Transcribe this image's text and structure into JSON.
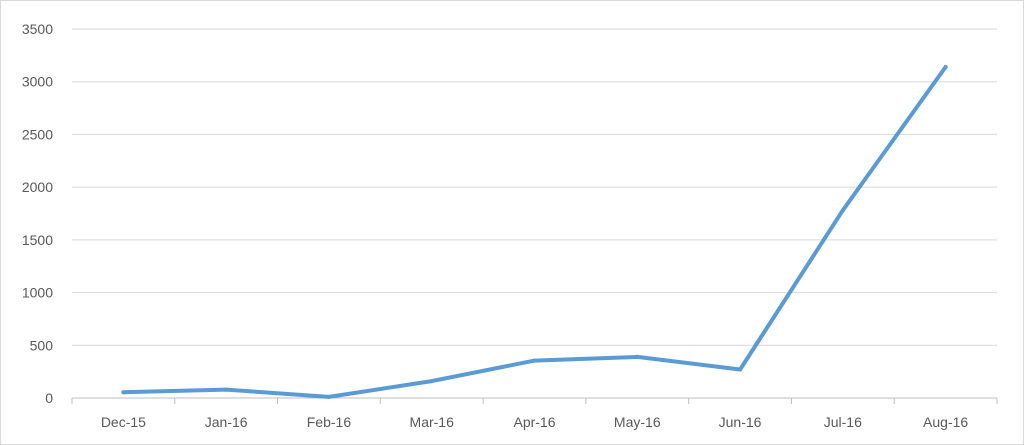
{
  "chart_data": {
    "type": "line",
    "title": "",
    "xlabel": "",
    "ylabel": "",
    "categories": [
      "Dec-15",
      "Jan-16",
      "Feb-16",
      "Mar-16",
      "Apr-16",
      "May-16",
      "Jun-16",
      "Jul-16",
      "Aug-16"
    ],
    "series": [
      {
        "values": [
          55,
          80,
          10,
          160,
          355,
          390,
          270,
          1780,
          3140
        ]
      }
    ],
    "ylim": [
      0,
      3500
    ],
    "yticks": [
      "0",
      "500",
      "1000",
      "1500",
      "2000",
      "2500",
      "3000",
      "3500"
    ],
    "grid": true,
    "legend": "none",
    "colors": {
      "line": "#5b9bd5",
      "grid": "#d9d9d9",
      "text": "#595959"
    }
  }
}
